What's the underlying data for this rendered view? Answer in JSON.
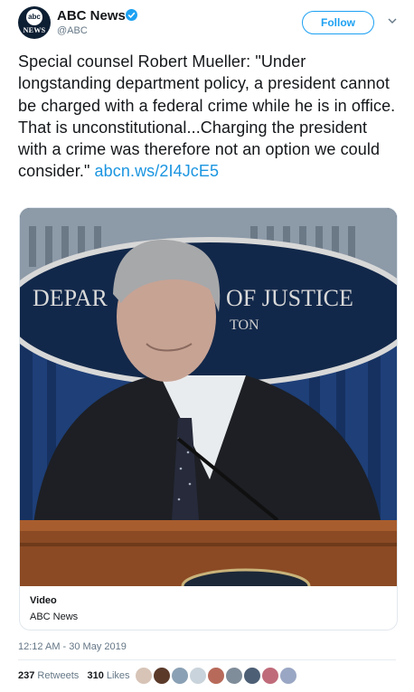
{
  "account": {
    "name": "ABC News",
    "handle": "@ABC",
    "avatar_top": "abc",
    "avatar_bottom": "NEWS",
    "follow_label": "Follow"
  },
  "tweet": {
    "text": "Special counsel Robert Mueller: \"Under longstanding department policy, a president cannot be charged with a federal crime while he is in office. That is unconstitutional...Charging the president with a crime was therefore not an option we could consider.\"",
    "link": "abcn.ws/2I4JcE5"
  },
  "card": {
    "title": "Video",
    "source": "ABC News",
    "seal_text_left": "DEPAR",
    "seal_text_right": "OF JUSTICE",
    "seal_text_small": "TON"
  },
  "timestamp": "12:12 AM - 30 May 2019",
  "stats": {
    "retweets_count": "237",
    "retweets_label": "Retweets",
    "likes_count": "310",
    "likes_label": "Likes"
  },
  "colors": {
    "link": "#1b95e0",
    "verified": "#1da1f2",
    "muted": "#657786"
  },
  "icons": [
    "verified-badge-icon",
    "chevron-down-icon"
  ]
}
